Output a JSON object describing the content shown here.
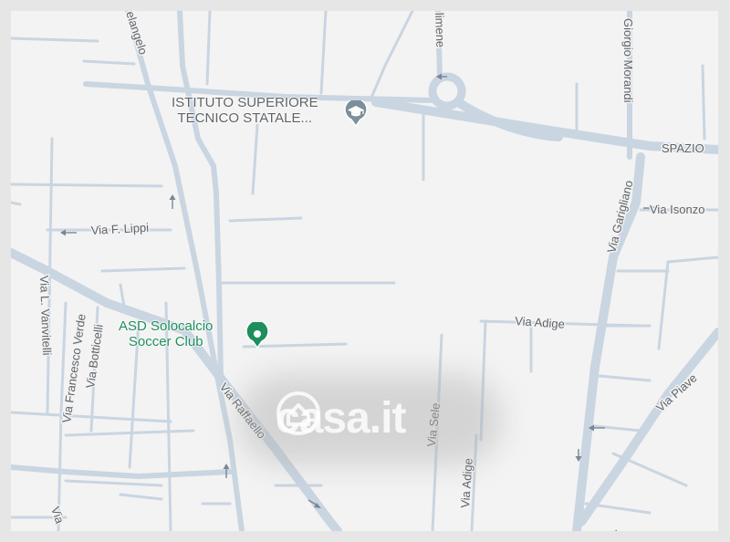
{
  "map": {
    "colors": {
      "background": "#f3f3f3",
      "road": "#c9d5e1",
      "label": "#5f6368",
      "poi_green": "#1e8e5c",
      "school_pin": "#7d8f9c"
    },
    "streets": {
      "michelangelo": "elangelo",
      "cimene": "limene",
      "giorgio_morandi": "Giorgio Morandi",
      "spazio": "SPAZIO",
      "via_isonzo": "Via Isonzo",
      "via_garigliano": "Via Garigliano",
      "via_f_lippi": "Via F. Lippi",
      "via_vanvitelli": "Via L. Vanvitelli",
      "via_francesco_verde": "Via Francesco Verde",
      "via_botticelli": "Via Botticelli",
      "via_adige_h": "Via Adige",
      "via_adige_v": "Via Adige",
      "via_sele": "Via Sele",
      "via_raffaello": "Via Raffaello",
      "via_piave": "Via Piave",
      "edge_via": "Via"
    },
    "pois": {
      "school": {
        "line1": "ISTITUTO SUPERIORE",
        "line2": "TECNICO STATALE...",
        "icon": "graduation-cap-icon"
      },
      "club": {
        "line1": "ASD Solocalcio",
        "line2": "Soccer Club",
        "icon": "place-pin-icon"
      }
    },
    "watermark": {
      "text": "casa.it",
      "icon": "house-icon"
    }
  }
}
